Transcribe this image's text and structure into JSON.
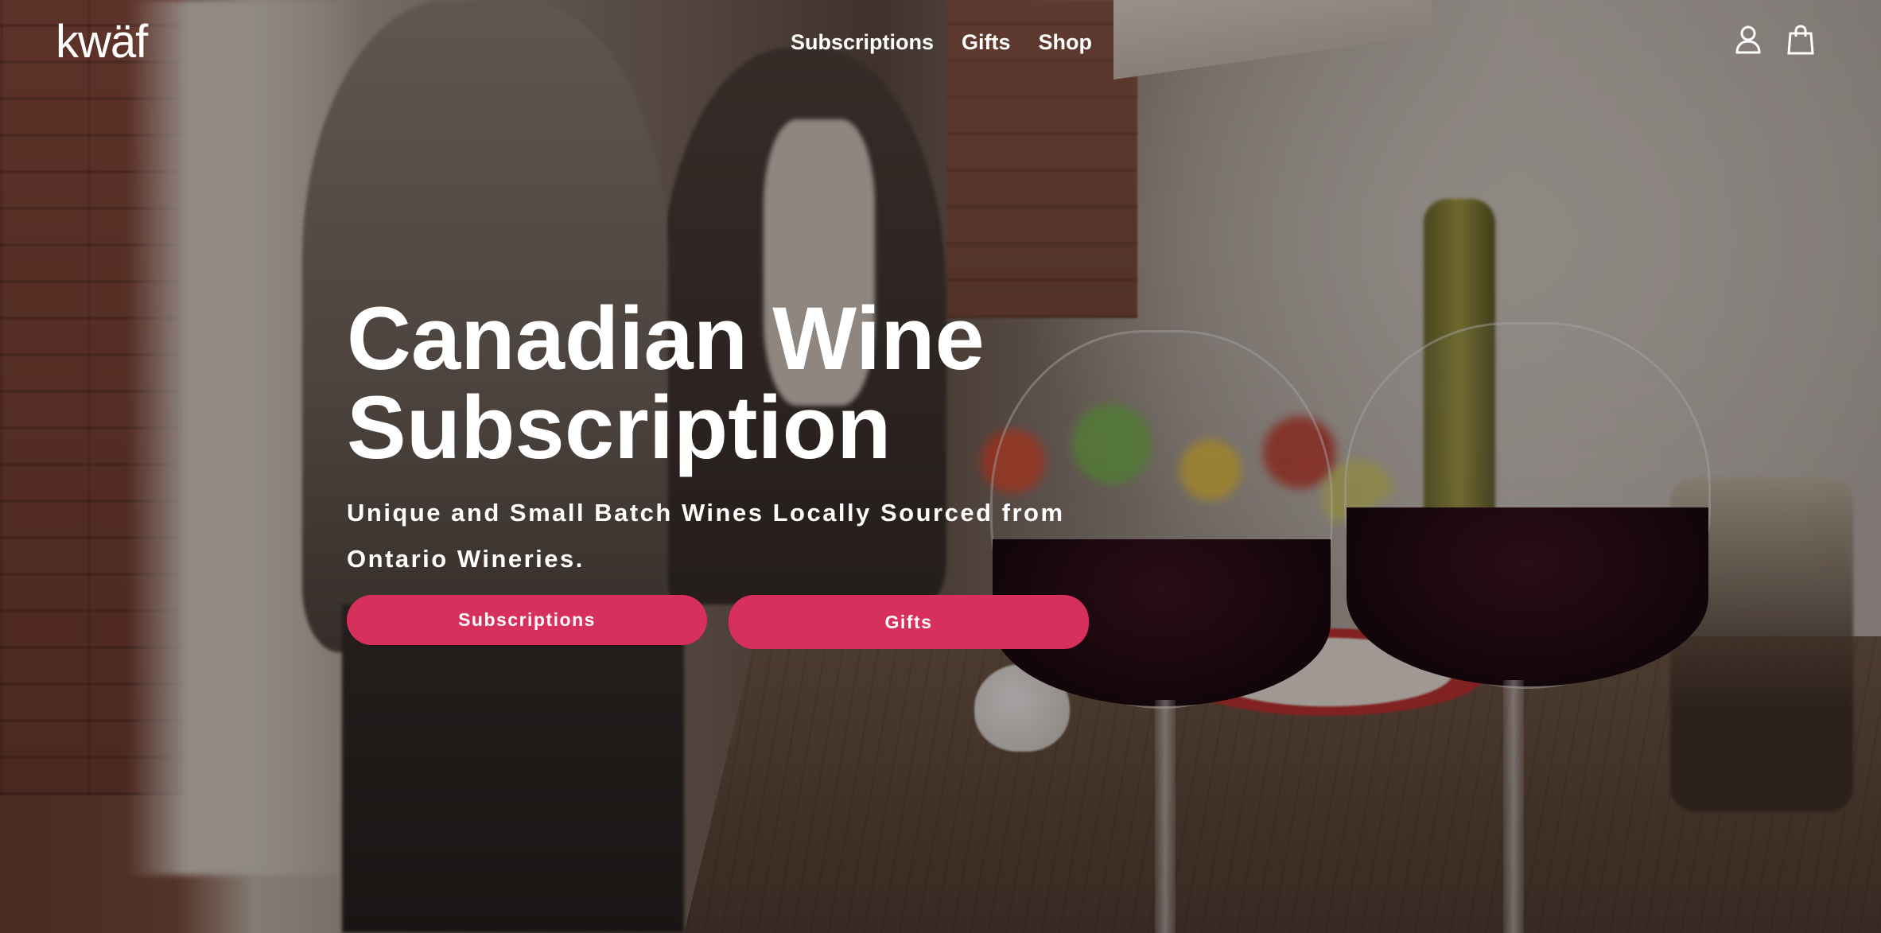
{
  "brand": {
    "logo_text": "kwäf",
    "accent_color": "#d8305d"
  },
  "nav": {
    "items": [
      {
        "label": "Subscriptions"
      },
      {
        "label": "Gifts"
      },
      {
        "label": "Shop"
      }
    ]
  },
  "header_icons": {
    "account": "account-icon",
    "cart": "shopping-bag-icon"
  },
  "hero": {
    "title_line1": "Canadian Wine",
    "title_line2": "Subscription",
    "subtitle": "Unique and Small Batch Wines Locally Sourced from Ontario Wineries.",
    "buttons": [
      {
        "label": "Subscriptions"
      },
      {
        "label": "Gifts"
      }
    ]
  }
}
